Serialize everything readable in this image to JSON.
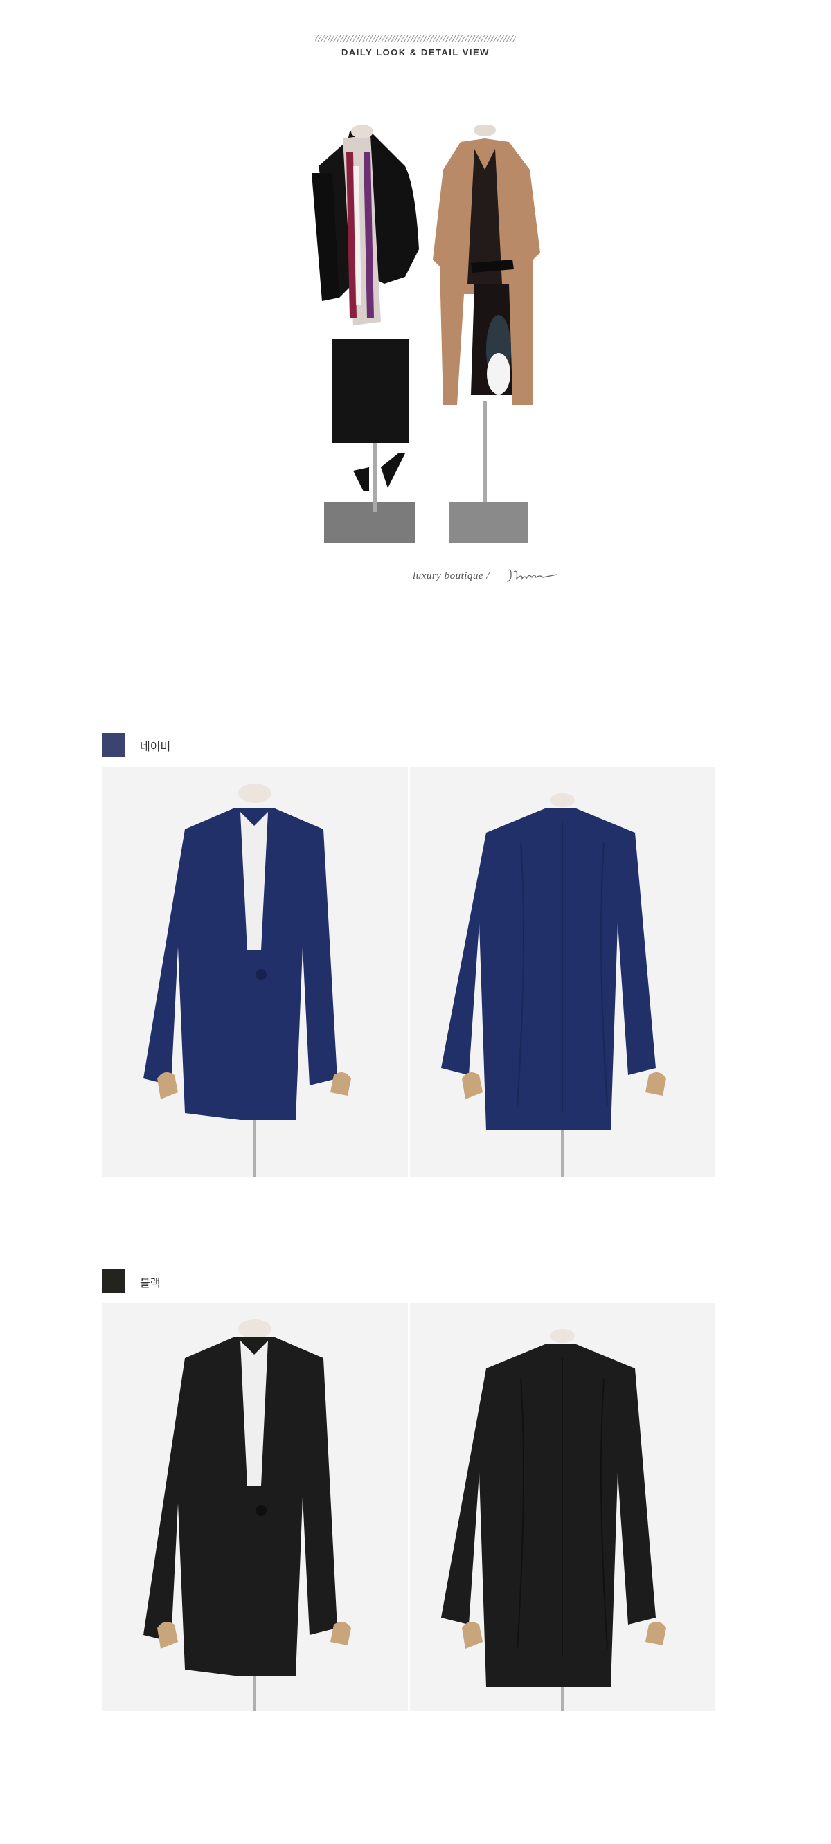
{
  "header": {
    "title": "DAILY LOOK & DETAIL VIEW"
  },
  "brand": {
    "tagline": "luxury boutique",
    "separator": "/",
    "logo_text": "Jblanc"
  },
  "colors": [
    {
      "label": "네이비",
      "swatch": "#3b4470",
      "fabric": "#22306a"
    },
    {
      "label": "블랙",
      "swatch": "#24241e",
      "fabric": "#1c1c1c"
    }
  ]
}
